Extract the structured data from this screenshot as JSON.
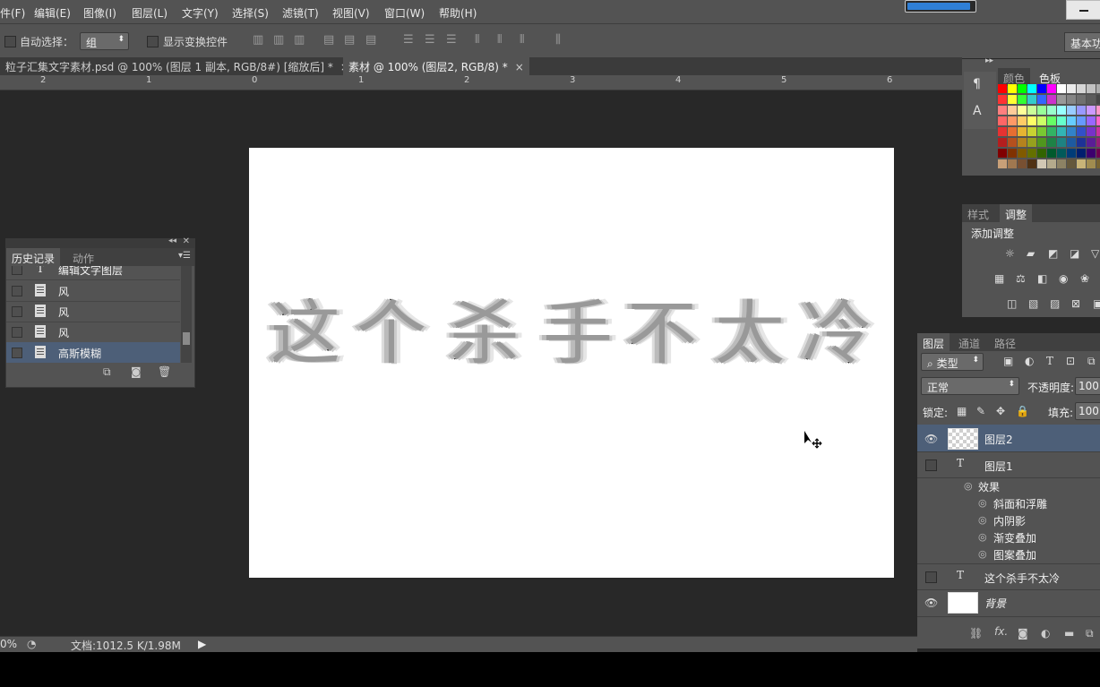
{
  "menu": [
    "件(F)",
    "编辑(E)",
    "图像(I)",
    "图层(L)",
    "文字(Y)",
    "选择(S)",
    "滤镜(T)",
    "视图(V)",
    "窗口(W)",
    "帮助(H)"
  ],
  "options": {
    "auto_select_label": "自动选择：",
    "auto_select_value": "组",
    "show_transform_label": "显示变换控件",
    "workspace": "基本功"
  },
  "tabs": [
    {
      "label": "粒子汇集文字素材.psd @ 100% (图层 1 副本, RGB/8#) [缩放后] *",
      "close": "×"
    },
    {
      "label": "素材 @ 100% (图层2, RGB/8) *",
      "close": "×"
    }
  ],
  "ruler": [
    "2",
    "1",
    "0",
    "1",
    "2",
    "3",
    "4",
    "5",
    "6"
  ],
  "canvas_text": [
    "这",
    "个",
    "杀",
    "手",
    "不",
    "太",
    "冷"
  ],
  "history": {
    "tabs": [
      "历史记录",
      "动作"
    ],
    "items": [
      "编辑文字图层",
      "风",
      "风",
      "风",
      "高斯模糊"
    ],
    "selected": "高斯模糊"
  },
  "swatches": {
    "tabs": [
      "颜色",
      "色板"
    ],
    "colors": [
      [
        "#ff0000",
        "#ffff00",
        "#00ff00",
        "#00ffff",
        "#0000ff",
        "#ff00ff",
        "#ffffff",
        "#ebebeb",
        "#d6d6d6",
        "#c2c2c2",
        "#adadad"
      ],
      [
        "#ff3333",
        "#ffff33",
        "#33ff33",
        "#33cccc",
        "#3366ff",
        "#cc33cc",
        "#999999",
        "#858585",
        "#707070",
        "#5c5c5c",
        "#474747"
      ],
      [
        "#ff7f7f",
        "#ffcc99",
        "#ffff99",
        "#ccff99",
        "#99ff99",
        "#99ffcc",
        "#99ffff",
        "#99ccff",
        "#9999ff",
        "#cc99ff",
        "#ff99cc"
      ],
      [
        "#ff6666",
        "#ff9966",
        "#ffcc66",
        "#ffff66",
        "#ccff66",
        "#66ff66",
        "#66ffcc",
        "#66ccff",
        "#6699ff",
        "#9966ff",
        "#ff66cc"
      ],
      [
        "#e63232",
        "#e66e32",
        "#e6b432",
        "#c8d232",
        "#78c832",
        "#32b464",
        "#32b4b4",
        "#3282c8",
        "#3250c8",
        "#7832c8",
        "#c832a0"
      ],
      [
        "#b41e1e",
        "#b4501e",
        "#b4821e",
        "#96a01e",
        "#50961e",
        "#1e8246",
        "#1e8282",
        "#1e5aa0",
        "#1e3296",
        "#5a1e96",
        "#961e78"
      ],
      [
        "#800000",
        "#803200",
        "#805a00",
        "#647000",
        "#326400",
        "#005a2d",
        "#005a5a",
        "#003c78",
        "#001e6e",
        "#3c006e",
        "#6e0050"
      ],
      [
        "#c8a078",
        "#a07850",
        "#785032",
        "#503214",
        "#d2c8b4",
        "#b4aa8c",
        "#8c8264",
        "#64583c",
        "#c8b478",
        "#a08c50",
        "#786432"
      ]
    ]
  },
  "adjustments": {
    "tabs": [
      "样式",
      "调整"
    ],
    "title": "添加调整"
  },
  "layers": {
    "tabs": [
      "图层",
      "通道",
      "路径"
    ],
    "filter_label": "类型",
    "blend_mode": "正常",
    "opacity_label": "不透明度:",
    "opacity_value": "100",
    "lock_label": "锁定:",
    "fill_label": "填充:",
    "fill_value": "100",
    "list": [
      {
        "name": "图层2",
        "kind": "pixel",
        "visible": true,
        "selected": true
      },
      {
        "name": "图层1",
        "kind": "text",
        "visible": false
      },
      {
        "name": "这个杀手不太冷",
        "kind": "text",
        "visible": false
      },
      {
        "name": "背景",
        "kind": "background",
        "visible": true
      }
    ],
    "effects_label": "效果",
    "effects": [
      "斜面和浮雕",
      "内阴影",
      "渐变叠加",
      "图案叠加"
    ]
  },
  "status": {
    "zoom": "0%",
    "doc": "文档:1012.5 K/1.98M"
  }
}
